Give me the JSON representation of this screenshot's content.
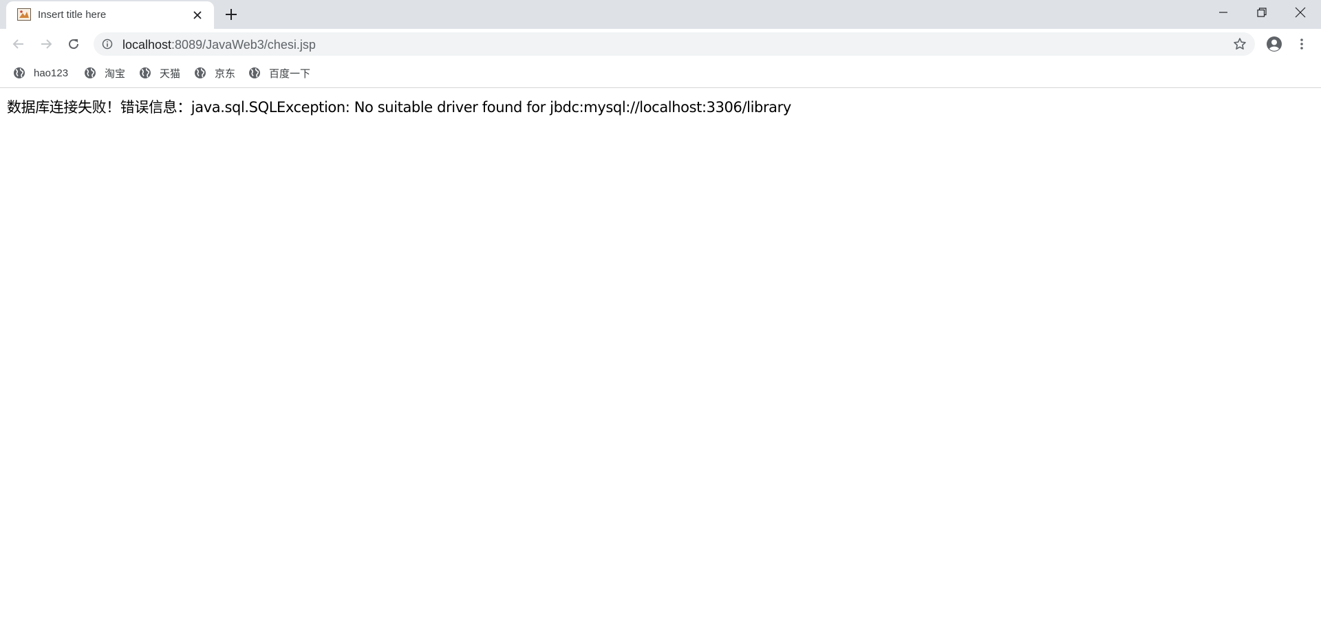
{
  "tab": {
    "title": "Insert title here"
  },
  "toolbar": {
    "url_host": "localhost",
    "url_rest": ":8089/JavaWeb3/chesi.jsp"
  },
  "bookmarks": [
    {
      "label": "hao123",
      "icon": "globe-icon"
    },
    {
      "label": "淘宝",
      "icon": "globe-icon"
    },
    {
      "label": "天猫",
      "icon": "globe-icon"
    },
    {
      "label": "京东",
      "icon": "globe-icon"
    },
    {
      "label": "百度一下",
      "icon": "globe-icon"
    }
  ],
  "page": {
    "message": "数据库连接失败！错误信息：java.sql.SQLException: No suitable driver found for jbdc:mysql://localhost:3306/library"
  },
  "colors": {
    "tabstrip_bg": "#dee1e6",
    "omnibox_bg": "#f1f3f4",
    "icon_gray": "#5f6368"
  }
}
